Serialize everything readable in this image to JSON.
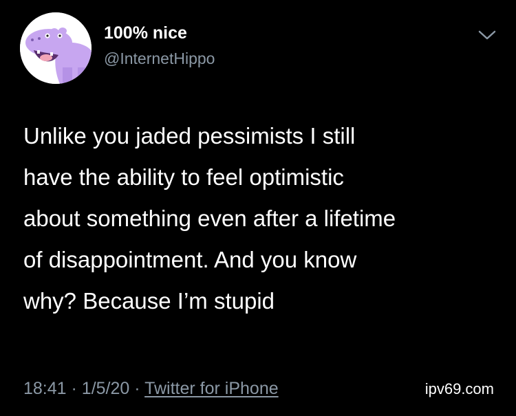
{
  "author": {
    "display_name": "100% nice",
    "handle": "@InternetHippo",
    "avatar_icon": "purple-hippo-icon",
    "avatar_color": "#c7a6f0"
  },
  "tweet": {
    "lines": [
      "Unlike you jaded pessimists I still",
      "have the ability to feel optimistic",
      "about something even after a lifetime",
      "of disappointment. And you know",
      "why? Because I’m stupid"
    ]
  },
  "meta": {
    "time": "18:41",
    "separator": "·",
    "date": "1/5/20",
    "source": "Twitter for iPhone"
  },
  "menu_icon": "chevron-down-icon",
  "watermark": "ipv69.com",
  "colors": {
    "background": "#000000",
    "text": "#ffffff",
    "secondary_text": "#8b98a5"
  }
}
